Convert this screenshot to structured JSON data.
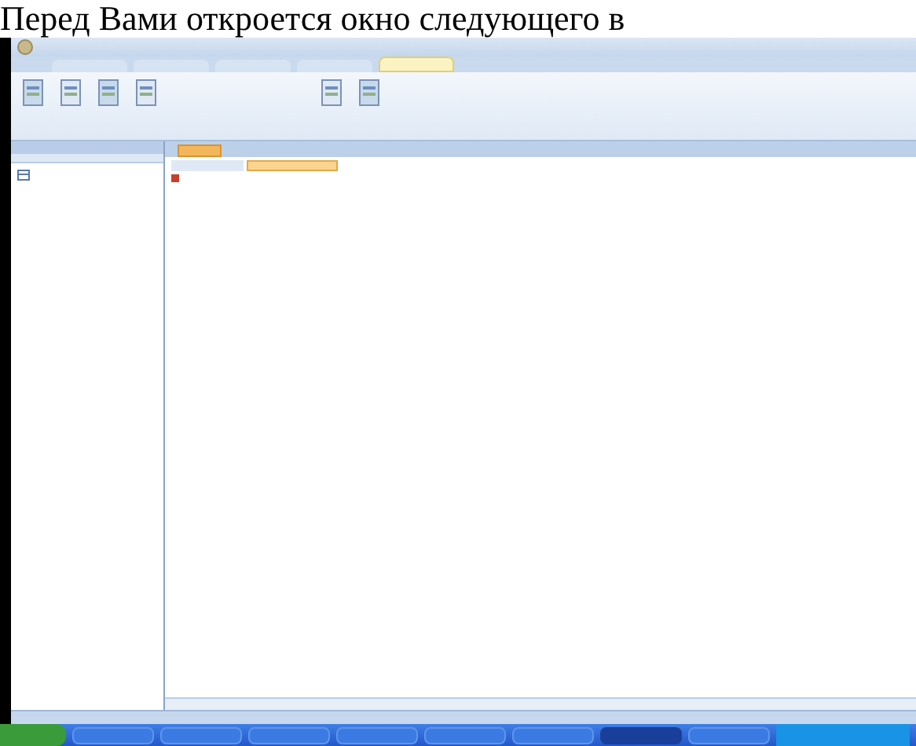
{
  "document_text": "Перед Вами откроется окно следующего в",
  "ribbon_tabs": [
    {
      "selected": false
    },
    {
      "selected": false
    },
    {
      "selected": false
    },
    {
      "selected": false
    },
    {
      "selected": true
    }
  ],
  "taskbar_items": [
    {
      "selected": false
    },
    {
      "selected": false
    },
    {
      "selected": false
    },
    {
      "selected": false
    },
    {
      "selected": false
    },
    {
      "selected": false
    },
    {
      "selected": true
    },
    {
      "selected": false
    }
  ]
}
